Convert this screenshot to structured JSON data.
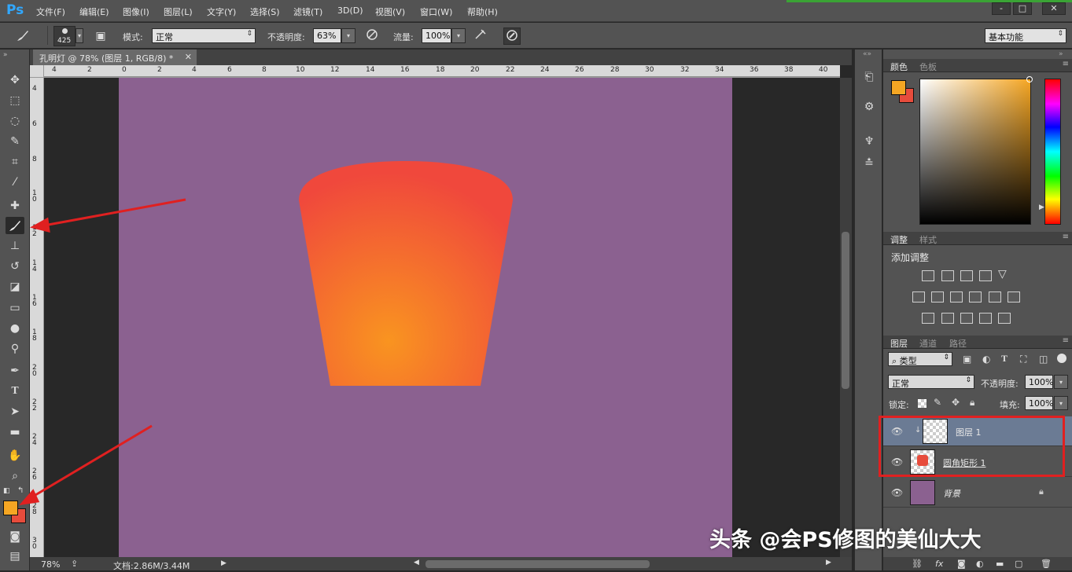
{
  "app": {
    "logo": "Ps",
    "menu": [
      "文件(F)",
      "编辑(E)",
      "图像(I)",
      "图层(L)",
      "文字(Y)",
      "选择(S)",
      "滤镜(T)",
      "3D(D)",
      "视图(V)",
      "窗口(W)",
      "帮助(H)"
    ],
    "window_buttons": [
      "-",
      "□",
      "✕"
    ]
  },
  "options_bar": {
    "brush_size": "425",
    "mode_label": "模式:",
    "mode_value": "正常",
    "opacity_label": "不透明度:",
    "opacity_value": "63%",
    "flow_label": "流量:",
    "flow_value": "100%",
    "workspace": "基本功能"
  },
  "document": {
    "tab_title": "孔明灯 @ 78% (图层 1, RGB/8) *",
    "zoom": "78%",
    "doc_size": "文档:2.86M/3.44M",
    "canvas_color": "#8b6190",
    "lantern_colors": [
      "#f0483c",
      "#f99420"
    ]
  },
  "rulers": {
    "top": [
      "4",
      "2",
      "0",
      "2",
      "4",
      "6",
      "8",
      "10",
      "12",
      "14",
      "16",
      "18",
      "20",
      "22",
      "24",
      "26",
      "28",
      "30",
      "32",
      "34",
      "36",
      "38",
      "40"
    ],
    "left": [
      "4",
      "6",
      "8",
      "10",
      "12",
      "14",
      "16",
      "18",
      "20",
      "22",
      "24",
      "26",
      "28",
      "30"
    ]
  },
  "color_panel": {
    "tabs": [
      "颜色",
      "色板"
    ],
    "foreground": "#f5a623",
    "background": "#e74c3c"
  },
  "adjust_panel": {
    "tabs": [
      "调整",
      "样式"
    ],
    "title": "添加调整"
  },
  "layers_panel": {
    "tabs": [
      "图层",
      "通道",
      "路径"
    ],
    "filter_type": "类型",
    "blend_mode": "正常",
    "opacity_label": "不透明度:",
    "opacity_value": "100%",
    "lock_label": "锁定:",
    "fill_label": "填充:",
    "fill_value": "100%",
    "layers": [
      {
        "name": "图层 1",
        "selected": true
      },
      {
        "name": "圆角矩形 1",
        "selected": false
      },
      {
        "name": "背景",
        "selected": false
      }
    ]
  },
  "watermark": "头条 @会PS修图的美仙大大"
}
